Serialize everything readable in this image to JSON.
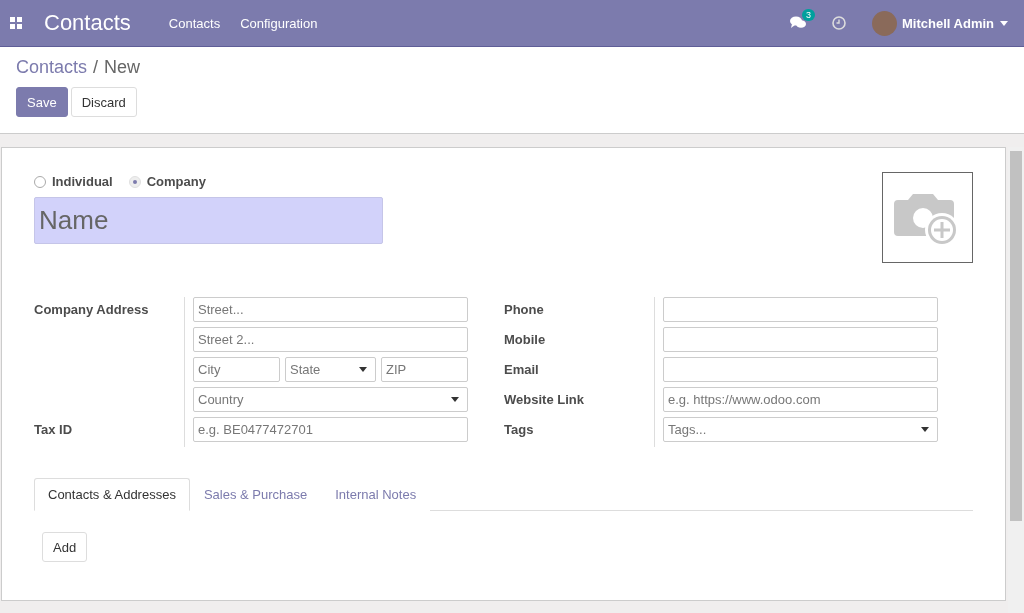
{
  "navbar": {
    "app_title": "Contacts",
    "menu": [
      "Contacts",
      "Configuration"
    ],
    "messages_badge": "3",
    "user": "Mitchell Admin"
  },
  "breadcrumb": {
    "parent": "Contacts",
    "separator": "/",
    "current": "New"
  },
  "actions": [
    {
      "label": "Save",
      "kind": "primary"
    },
    {
      "label": "Discard",
      "kind": "secondary"
    }
  ],
  "company_type": [
    {
      "label": "Individual",
      "selected": false
    },
    {
      "label": "Company",
      "selected": true
    }
  ],
  "name_field": {
    "placeholder": "Name"
  },
  "left_group": [
    {
      "label": "Company Address",
      "fields": [
        {
          "placeholder": "Street...",
          "kind": "text"
        }
      ]
    },
    {
      "fields": [
        {
          "placeholder": "Street 2...",
          "kind": "text"
        }
      ]
    },
    {
      "fields": [
        {
          "placeholder": "City",
          "kind": "text"
        },
        {
          "placeholder": "State",
          "kind": "select"
        },
        {
          "placeholder": "ZIP",
          "kind": "text"
        }
      ]
    },
    {
      "fields": [
        {
          "placeholder": "Country",
          "kind": "select"
        }
      ]
    },
    {
      "label": "Tax ID",
      "fields": [
        {
          "placeholder": "e.g. BE0477472701",
          "kind": "text"
        }
      ]
    }
  ],
  "right_group": [
    {
      "label": "Phone",
      "fields": [
        {
          "kind": "text"
        }
      ]
    },
    {
      "label": "Mobile",
      "fields": [
        {
          "kind": "text"
        }
      ]
    },
    {
      "label": "Email",
      "fields": [
        {
          "kind": "text"
        }
      ]
    },
    {
      "label": "Website Link",
      "fields": [
        {
          "placeholder": "e.g. https://www.odoo.com",
          "kind": "text"
        }
      ]
    },
    {
      "label": "Tags",
      "fields": [
        {
          "placeholder": "Tags...",
          "kind": "select"
        }
      ]
    }
  ],
  "notebook_tabs": [
    {
      "label": "Contacts & Addresses",
      "selected": true
    },
    {
      "label": "Sales & Purchase",
      "selected": false
    },
    {
      "label": "Internal Notes",
      "selected": false
    }
  ],
  "add_button": "Add"
}
